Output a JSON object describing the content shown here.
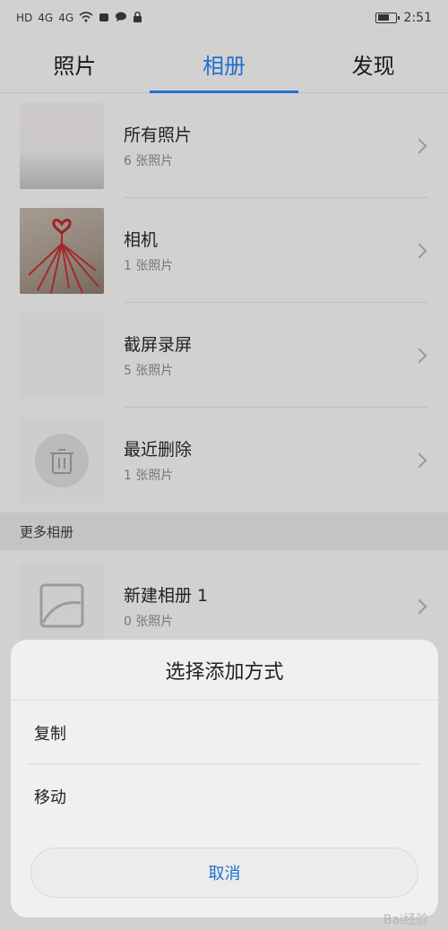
{
  "status_bar": {
    "left_icons": [
      "HD",
      "4G",
      "4G",
      "wifi-icon",
      "alarm-icon",
      "message-icon",
      "lock-icon"
    ],
    "time": "2:51"
  },
  "tabs": [
    {
      "label": "照片",
      "active": false
    },
    {
      "label": "相册",
      "active": true
    },
    {
      "label": "发现",
      "active": false
    }
  ],
  "albums": [
    {
      "name": "所有照片",
      "count": "6 张照片"
    },
    {
      "name": "相机",
      "count": "1 张照片"
    },
    {
      "name": "截屏录屏",
      "count": "5 张照片"
    },
    {
      "name": "最近删除",
      "count": "1 张照片"
    }
  ],
  "section_more": {
    "title": "更多相册"
  },
  "more_albums": [
    {
      "name": "新建相册 1",
      "count": "0 张照片"
    }
  ],
  "sheet": {
    "title": "选择添加方式",
    "options": [
      "复制",
      "移动"
    ],
    "cancel": "取消"
  },
  "watermark": "Bai经验",
  "colors": {
    "accent": "#1f6fd1"
  }
}
